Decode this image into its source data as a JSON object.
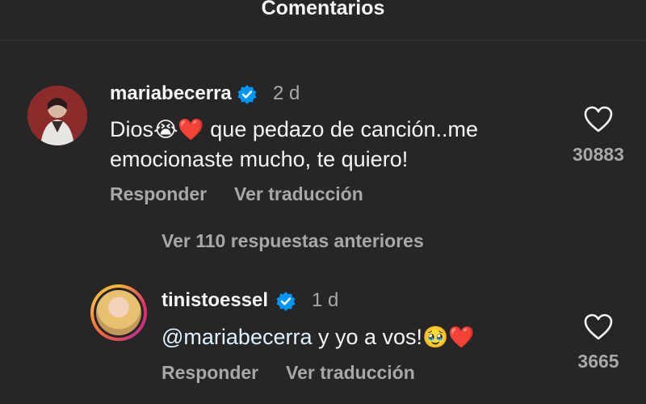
{
  "header": {
    "title": "Comentarios"
  },
  "comments": [
    {
      "username": "mariabecerra",
      "time": "2 d",
      "text_line1_before": "Dios",
      "text_line1_emoji": "😭❤️",
      "text_line1_after": " que pedazo de canción..me",
      "text_line2": "emocionaste mucho, te quiero!",
      "reply_label": "Responder",
      "translate_label": "Ver traducción",
      "likes": "30883"
    }
  ],
  "view_replies": "Ver 110 respuestas anteriores",
  "reply": {
    "username": "tinistoessel",
    "time": "1 d",
    "mention": "@mariabecerra",
    "text": " y yo a vos!",
    "emoji": "🥹❤️",
    "reply_label": "Responder",
    "translate_label": "Ver traducción",
    "likes": "3665"
  },
  "colors": {
    "background": "#262626",
    "secondary_text": "#a8a8a8",
    "verified": "#0095f6",
    "mention": "#e0f1ff"
  }
}
